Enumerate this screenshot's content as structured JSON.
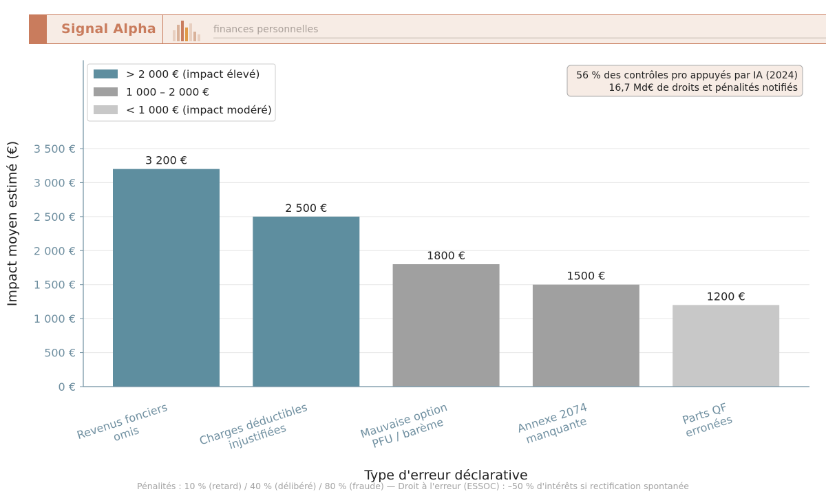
{
  "header": {
    "brand": "Signal Alpha",
    "tagline": "finances personnelles"
  },
  "colors": {
    "accent": "#c97c5d",
    "high": "#5e8e9f",
    "mid": "#a0a0a0",
    "low": "#c8c8c8",
    "axis_text": "#6f8fa0"
  },
  "chart_data": {
    "type": "bar",
    "title": "",
    "xlabel": "Type d'erreur déclarative",
    "ylabel": "Impact moyen estimé (€)",
    "ylim": [
      0,
      4800
    ],
    "yticks": [
      0,
      500,
      1000,
      1500,
      2000,
      2500,
      3000,
      3500
    ],
    "ytick_labels": [
      "0 €",
      "500 €",
      "1 000 €",
      "1 500 €",
      "2 000 €",
      "2 500 €",
      "3 000 €",
      "3 500 €"
    ],
    "grid": "horizontal",
    "categories": [
      [
        "Revenus fonciers",
        "omis"
      ],
      [
        "Charges déductibles",
        "injustifiées"
      ],
      [
        "Mauvaise option",
        "PFU / barème"
      ],
      [
        "Annexe 2074",
        "manquante"
      ],
      [
        "Parts QF",
        "erronées"
      ]
    ],
    "values": [
      3200,
      2500,
      1800,
      1500,
      1200
    ],
    "value_labels": [
      "3 200 €",
      "2 500 €",
      "1800 €",
      "1500 €",
      "1200 €"
    ],
    "bar_groups": [
      "high",
      "high",
      "mid",
      "mid",
      "low"
    ],
    "legend": {
      "position": "top-left",
      "entries": [
        {
          "group": "high",
          "label": "> 2 000 € (impact élevé)"
        },
        {
          "group": "mid",
          "label": "1 000 – 2 000 €"
        },
        {
          "group": "low",
          "label": "< 1 000 € (impact modéré)"
        }
      ]
    },
    "annotation": {
      "position": "top-right",
      "lines": [
        "56 % des contrôles pro appuyés par IA (2024)",
        "16,7 Md€ de droits et pénalités notifiés"
      ]
    }
  },
  "footnote": "Pénalités : 10 % (retard) / 40 % (délibéré) / 80 % (fraude)  —  Droit à l'erreur (ESSOC) : –50 % d'intérêts si rectification spontanée"
}
